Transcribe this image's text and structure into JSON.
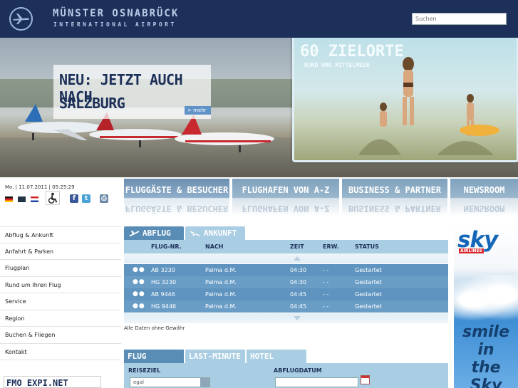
{
  "header": {
    "brand_title": "MÜNSTER OSNABRÜCK",
    "brand_sub": "INTERNATIONAL AIRPORT",
    "search_placeholder": "Suchen"
  },
  "hero": {
    "promo_line1": "NEU: JETZT AUCH NACH",
    "promo_line2": "SALZBURG",
    "promo_more": "> mehr",
    "teaser_title": "60 ZIELORTE",
    "teaser_sub": "RUND UMS MITTELMEER"
  },
  "left": {
    "datetime": "Mo. | 11.07.2011 | 05:25:29",
    "nav": [
      "Abflug & Ankunft",
      "Anfahrt & Parken",
      "Flugplan",
      "Rund um Ihren Flug",
      "Service",
      "Region",
      "Buchen & Fliegen",
      "Kontakt"
    ],
    "fmo_expi": "FMO EXPI.NET"
  },
  "main_tabs": [
    "FLUGGÄSTE & BESUCHER",
    "FLUGHAFEN VON A-Z",
    "BUSINESS & PARTNER",
    "NEWSROOM"
  ],
  "flight_board": {
    "tab_abflug": "ABFLUG",
    "tab_ankunft": "ANKUNFT",
    "columns": {
      "flight": "FLUG-NR.",
      "to": "NACH",
      "time": "ZEIT",
      "expected": "ERW.",
      "status": "STATUS"
    },
    "rows": [
      {
        "flight": "AB 3230",
        "to": "Palma d.M.",
        "time": "04:30",
        "expected": "- -",
        "status": "Gestartet"
      },
      {
        "flight": "HG 3230",
        "to": "Palma d.M.",
        "time": "04:30",
        "expected": "- -",
        "status": "Gestartet"
      },
      {
        "flight": "AB 9446",
        "to": "Palma d.M.",
        "time": "04:45",
        "expected": "- -",
        "status": "Gestartet"
      },
      {
        "flight": "HG 9446",
        "to": "Palma d.M.",
        "time": "04:45",
        "expected": "- -",
        "status": "Gestartet"
      }
    ],
    "disclaimer": "Alle Daten ohne Gewähr"
  },
  "booking": {
    "tab_flug": "FLUG",
    "tab_last": "LAST-MINUTE",
    "tab_hotel": "HOTEL",
    "reiseziel_label": "REISEZIEL",
    "reiseziel_value": "egal",
    "abflugdatum_label": "ABFLUGDATUM"
  },
  "ad": {
    "brand": "sky",
    "airlines": "AIRLINES",
    "slogan": [
      "smile",
      "in",
      "the",
      "Sky"
    ]
  }
}
